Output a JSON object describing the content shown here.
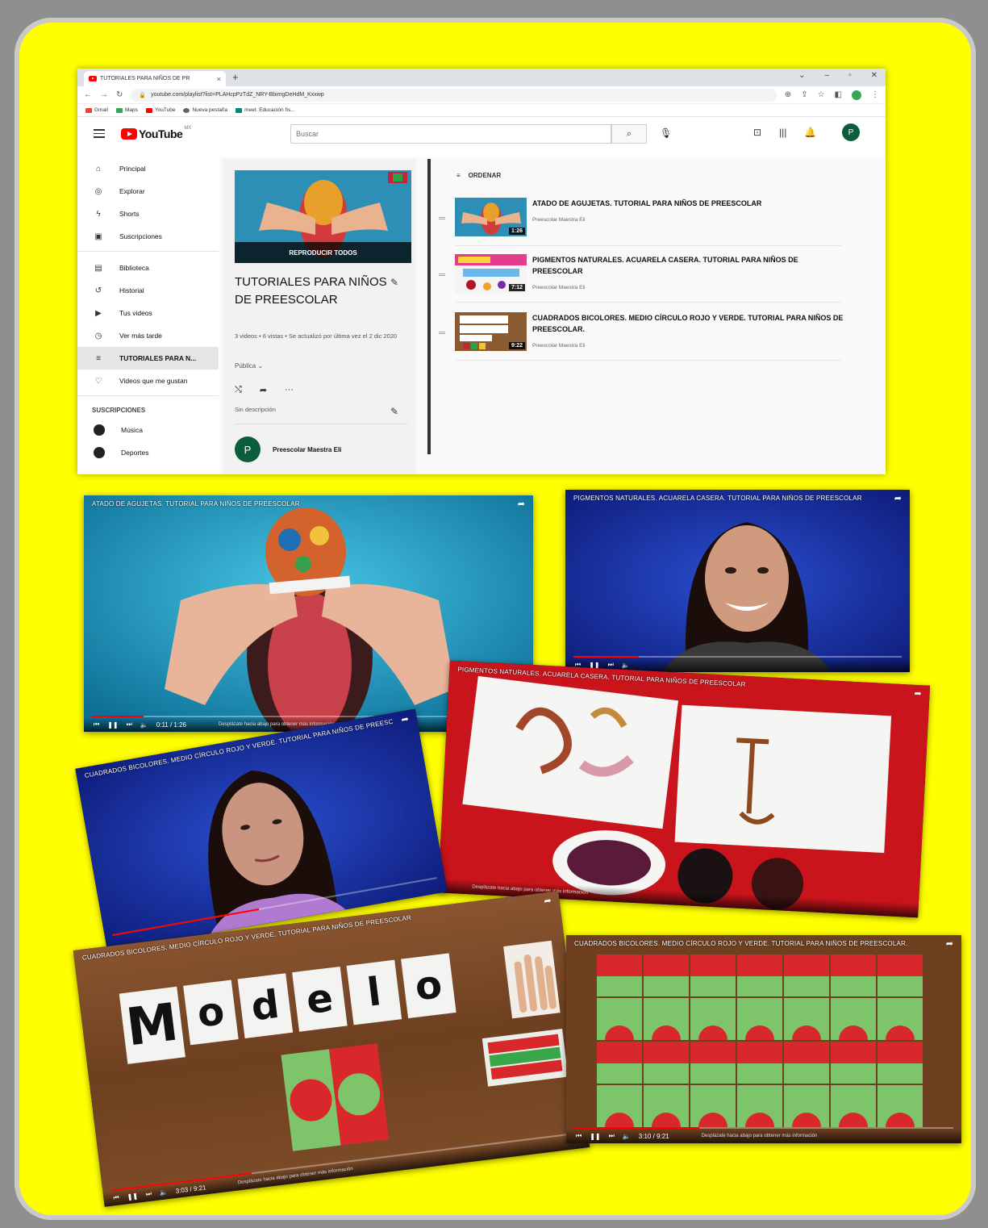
{
  "browser": {
    "tab_title": "TUTORIALES PARA NIÑOS DE PR",
    "tab_close": "×",
    "new_tab": "+",
    "url": "youtube.com/playlist?list=PLAHcpPzTdZ_NRY-BbimgDeHdM_Kxxwp",
    "bookmarks": [
      "Gmail",
      "Maps",
      "YouTube",
      "Nueva pestaña",
      "meet. Educación fís..."
    ]
  },
  "youtube": {
    "logo_text": "YouTube",
    "logo_sup": "MX",
    "search_placeholder": "Buscar",
    "user_initial": "P",
    "sidebar": {
      "items": [
        {
          "label": "Principal",
          "icon": "home-icon",
          "glyph": "⌂"
        },
        {
          "label": "Explorar",
          "icon": "compass-icon",
          "glyph": "◎"
        },
        {
          "label": "Shorts",
          "icon": "shorts-icon",
          "glyph": "ϟ"
        },
        {
          "label": "Suscripciones",
          "icon": "subscriptions-icon",
          "glyph": "▣"
        }
      ],
      "library": [
        {
          "label": "Biblioteca",
          "icon": "library-icon",
          "glyph": "▤"
        },
        {
          "label": "Historial",
          "icon": "history-icon",
          "glyph": "↺"
        },
        {
          "label": "Tus videos",
          "icon": "your-videos-icon",
          "glyph": "▶"
        },
        {
          "label": "Ver más tarde",
          "icon": "clock-icon",
          "glyph": "◷"
        },
        {
          "label": "TUTORIALES PARA N...",
          "icon": "playlist-icon",
          "glyph": "≡"
        },
        {
          "label": "Videos que me gustan",
          "icon": "thumbs-up-icon",
          "glyph": "👍"
        }
      ],
      "subscriptions_heading": "SUSCRIPCIONES",
      "subscriptions": [
        "Música",
        "Deportes"
      ]
    },
    "playlist": {
      "play_all": "REPRODUCIR TODOS",
      "title": "TUTORIALES PARA NIÑOS DE PREESCOLAR",
      "meta": "3 videos • 6 vistas • Se actualizó por última vez el 2 dic 2020",
      "privacy": "Pública",
      "description": "Sin descripción",
      "owner": "Preescolar Maestra Eli",
      "owner_initial": "P"
    },
    "sort_label": "ORDENAR",
    "videos": [
      {
        "title": "ATADO DE AGUJETAS. TUTORIAL PARA NIÑOS DE PREESCOLAR",
        "channel": "Preescolar Maestra Eli",
        "duration": "1:26"
      },
      {
        "title": "PIGMENTOS NATURALES. ACUARELA CASERA. TUTORIAL PARA NIÑOS DE PREESCOLAR",
        "channel": "Preescolar Maestra Eli",
        "duration": "7:12"
      },
      {
        "title": "CUADRADOS BICOLORES. MEDIO CÍRCULO ROJO Y VERDE. TUTORIAL PARA NIÑOS DE PREESCOLAR.",
        "channel": "Preescolar Maestra Eli",
        "duration": "9:22"
      }
    ]
  },
  "frames": {
    "f1_title": "ATADO DE AGUJETAS. TUTORIAL PARA NIÑOS DE PREESCOLAR",
    "f2_title": "PIGMENTOS NATURALES. ACUARELA CASERA. TUTORIAL PARA NIÑOS DE PREESCOLAR",
    "f3_title": "PIGMENTOS NATURALES. ACUARELA CASERA. TUTORIAL PARA NIÑOS DE PREESCOLAR",
    "f4_title": "CUADRADOS BICOLORES. MEDIO CÍRCULO ROJO Y VERDE. TUTORIAL PARA NIÑOS DE PREESCOLAR",
    "f5_title": "CUADRADOS BICOLORES. MEDIO CÍRCULO ROJO Y VERDE. TUTORIAL PARA NIÑOS DE PREESCOLAR",
    "f6_title": "CUADRADOS BICOLORES. MEDIO CÍRCULO ROJO Y VERDE. TUTORIAL PARA NIÑOS DE PREESCOLAR.",
    "modelo_letters": [
      "M",
      "o",
      "d",
      "e",
      "l",
      "o"
    ],
    "caption": "Desplázate hacia abajo para obtener más información",
    "f1_time": "0:11 / 1:26",
    "f5_time": "3:03 / 9:21",
    "f6_time": "3:10 / 9:21"
  },
  "colors": {
    "poster_yellow": "#ffff00",
    "yt_red": "#ff0000",
    "avatar_green": "#0b5d3b"
  }
}
